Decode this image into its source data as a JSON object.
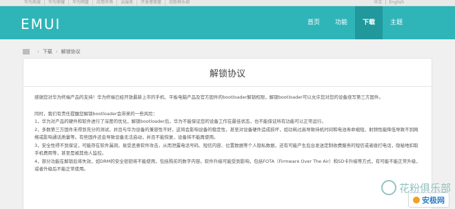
{
  "topbar": {
    "links": [
      "华为商城",
      "华为荣耀",
      "华为网盘",
      "应用市场",
      "云服务",
      "开发者联盟",
      "花粉俱乐部"
    ],
    "lang": [
      "中文",
      "English"
    ]
  },
  "header": {
    "logo": "EMUI",
    "nav": [
      {
        "label": "首页",
        "active": false
      },
      {
        "label": "功能",
        "active": false
      },
      {
        "label": "下载",
        "active": true
      },
      {
        "label": "主题",
        "active": false
      }
    ],
    "accent": "#2fb5b8"
  },
  "breadcrumb": {
    "items": [
      "下载",
      "解锁协议"
    ]
  },
  "content": {
    "title": "解锁协议",
    "intro": "感谢您对华为终端产品的支持！华为终端已经开放最新上市的手机、平板电脑产品及官方固件的bootloader解锁权限，解锁bootloader可以允许您对您的设备烧写第三方固件。",
    "warning_title": "同时，我们有责任提醒您解锁bootloader会带来的一些风险：",
    "items": [
      "1，华为对产品的硬件和软件进行了深度的优化，解锁bootloader后，华为不能保证您的设备工作在最佳状态，也不能保证所有功能可以正常运行。",
      "2，多数第三方固件未得到充分的测试，并且与华为设备的兼容性不好，这将会影响设备的稳定性，甚至对设备硬件造成损坏，如功耗过高导致待机时间和电池寿命缩短、射频性能降低导致不到网络或影响通话质量等。有些固件还会导致设备无法启动，并且不能恢复，设备将不能再使用。",
      "3，安全性得不到保证，可能存在软件漏洞，易受恶意软件攻击，从而泄露电话号码、短信内容、位置数据等个人隐私数据，还有可能产生后台发送定制收费服务的短信或者拨打电话，隐秘地扣取手机费用等，甚至是被其他人监控。",
      "4，部分功能在解锁后将失效，如DRM的安全密钥将不能使用，包括购买的数字内容。软件升级可能受到影响，包括FOTA（Firmware Over The Air）和SD卡升级等方式，有可能不能正常升级，或者升级后不能正常使用。"
    ]
  },
  "watermark": {
    "club": "花粉俱乐部",
    "site": "安极网"
  }
}
